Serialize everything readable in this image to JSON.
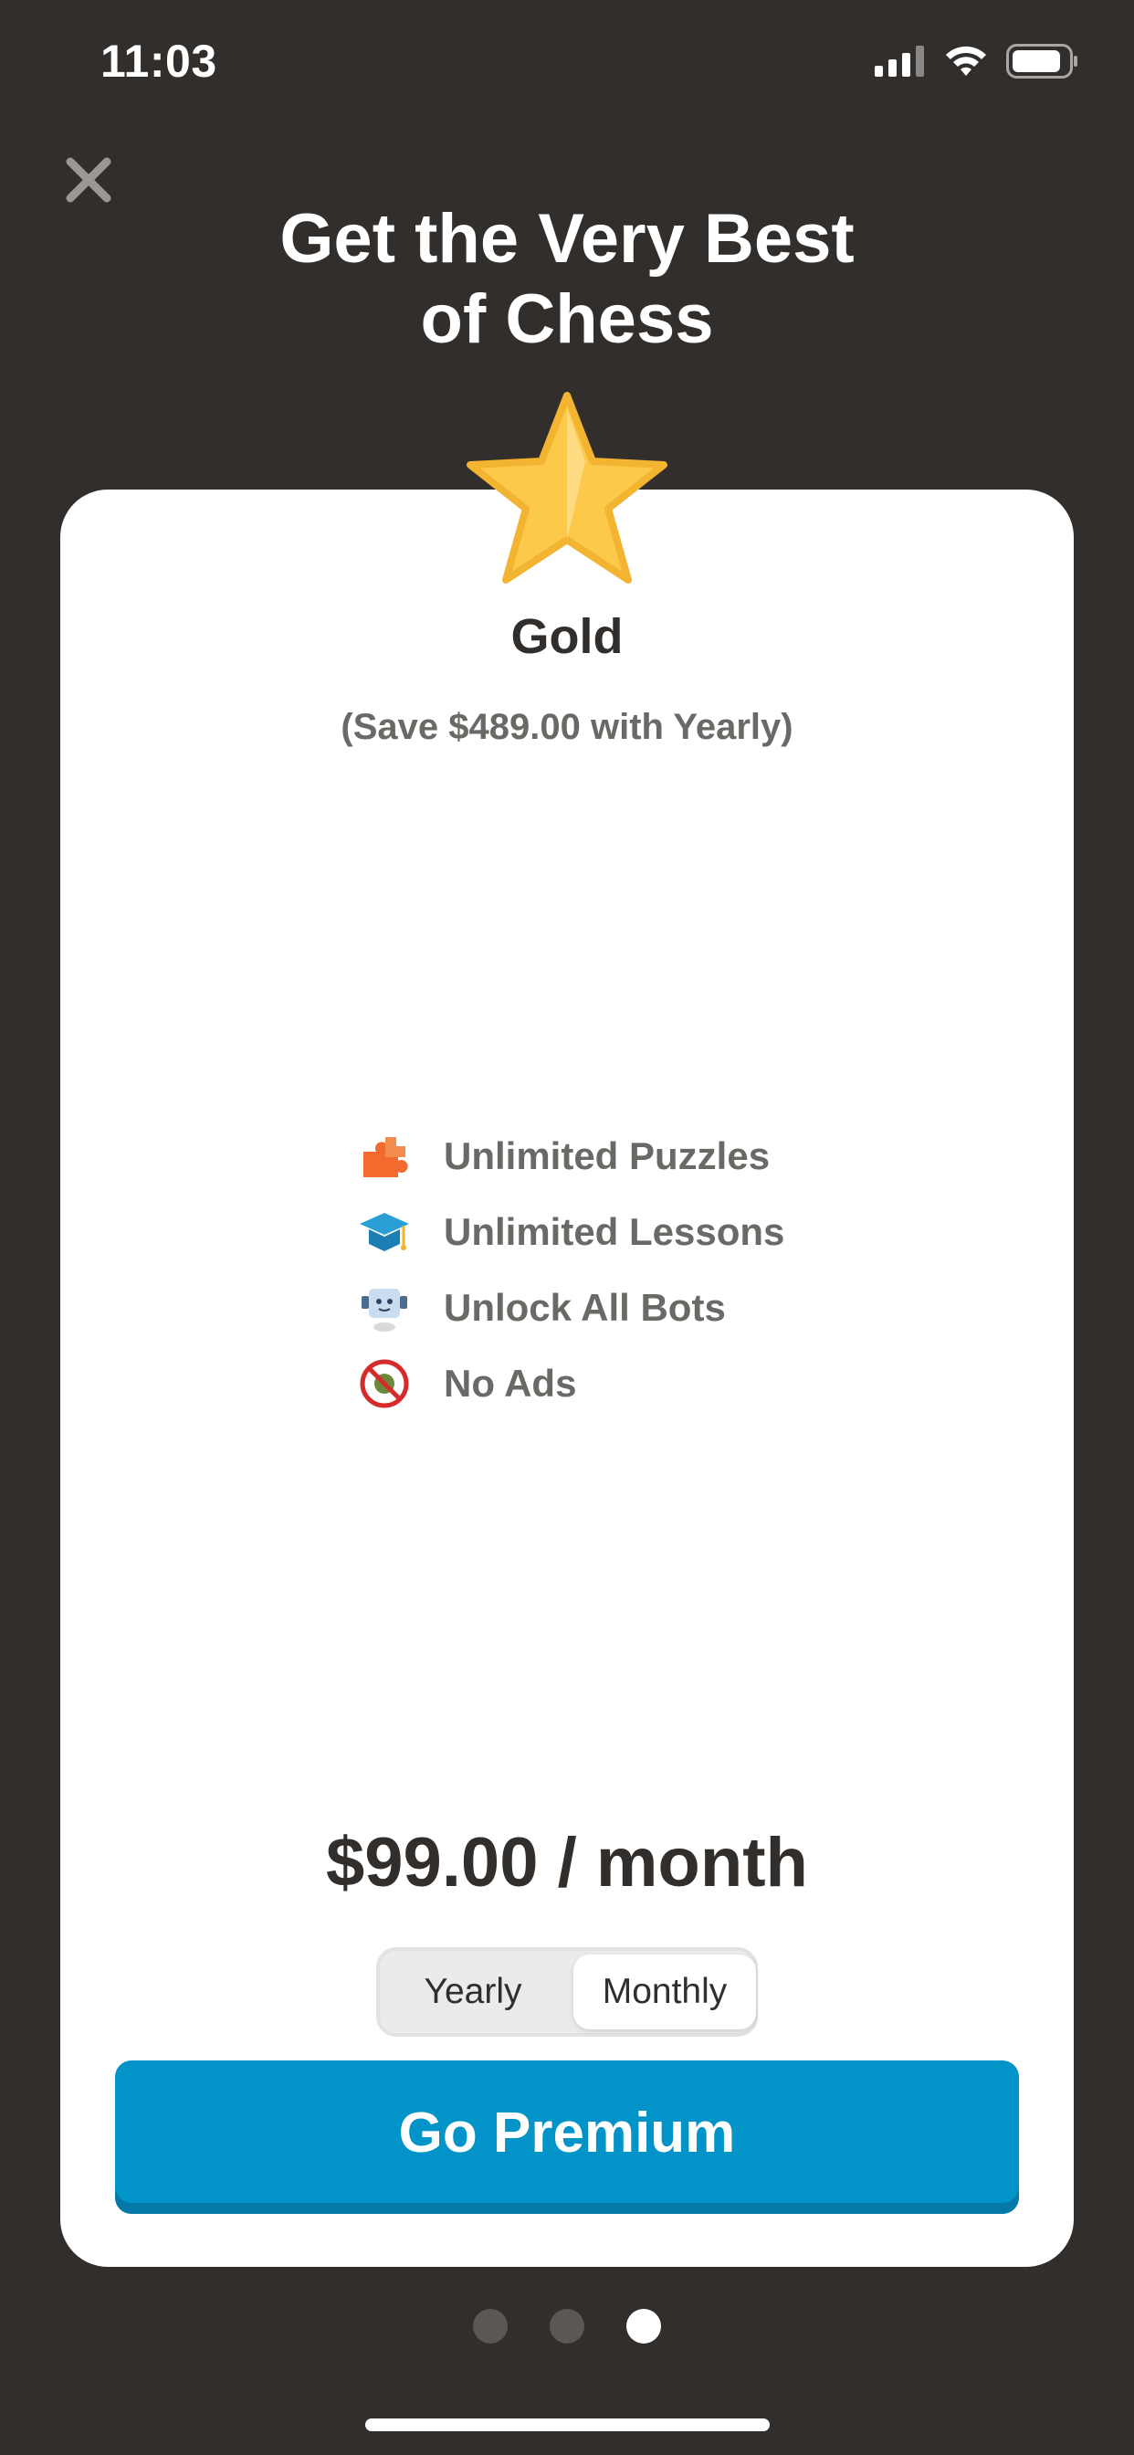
{
  "status_bar": {
    "time": "11:03",
    "icons": [
      "cellular-signal-icon",
      "wifi-icon",
      "battery-icon"
    ]
  },
  "close": {
    "icon": "close-icon"
  },
  "headline": {
    "line1": "Get the Very Best",
    "line2": "of Chess"
  },
  "plan": {
    "icon": "star-icon",
    "name": "Gold",
    "savings": "(Save $489.00 with Yearly)"
  },
  "features": [
    {
      "icon": "puzzle-icon",
      "label": "Unlimited Puzzles"
    },
    {
      "icon": "graduation-cap-icon",
      "label": "Unlimited Lessons"
    },
    {
      "icon": "robot-icon",
      "label": "Unlock All Bots"
    },
    {
      "icon": "no-ads-icon",
      "label": "No Ads"
    }
  ],
  "price": "$99.00 / month",
  "billing_toggle": {
    "options": [
      "Yearly",
      "Monthly"
    ],
    "selected": "Monthly"
  },
  "cta": {
    "label": "Go Premium"
  },
  "pagination": {
    "pages": 3,
    "current": 3
  },
  "colors": {
    "background": "#312e2b",
    "card": "#ffffff",
    "cta": "#0294c8",
    "star": "#fcc94a"
  }
}
